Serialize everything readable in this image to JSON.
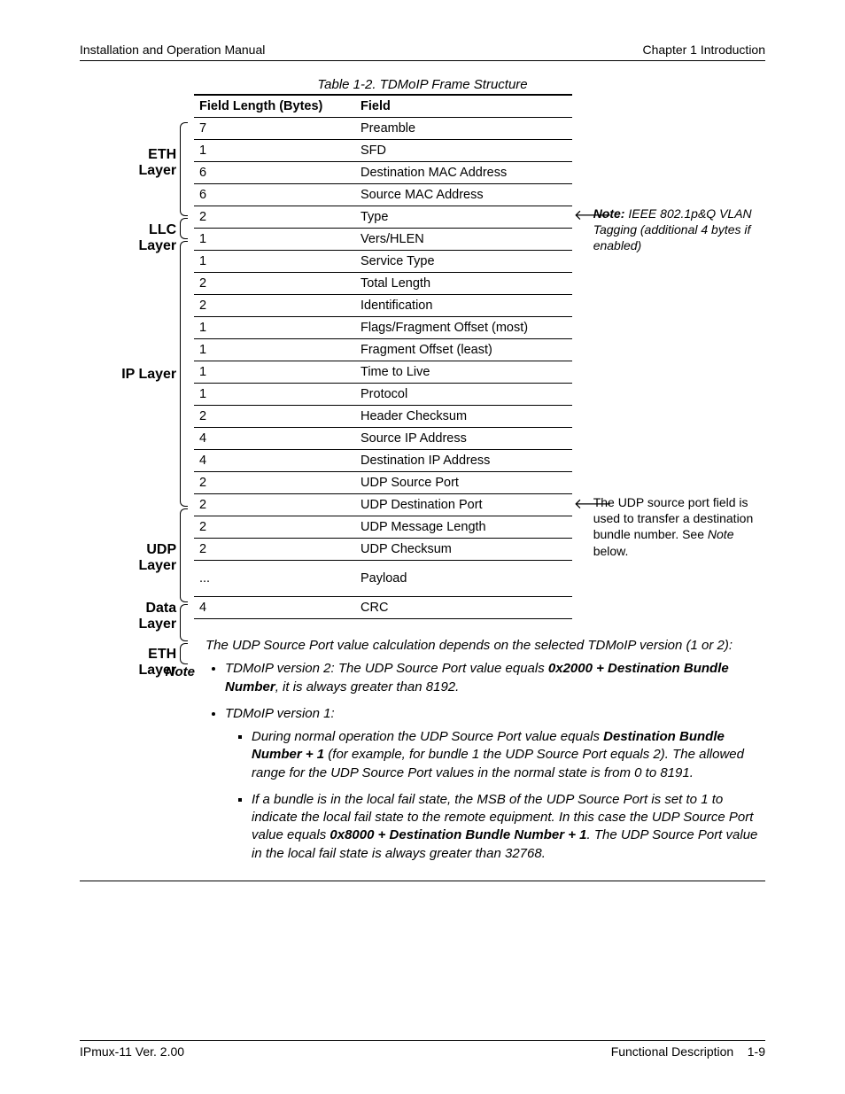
{
  "header": {
    "left": "Installation and Operation Manual",
    "right": "Chapter 1  Introduction"
  },
  "caption": "Table 1-2.  TDMoIP Frame Structure",
  "columns": {
    "c1": "Field Length (Bytes)",
    "c2": "Field"
  },
  "layers": {
    "eth": "ETH\nLayer",
    "llc": "LLC\nLayer",
    "ip": "IP Layer",
    "udp": "UDP\nLayer",
    "data": "Data\nLayer",
    "eth2": "ETH\nLayer"
  },
  "rows": [
    {
      "len": "7",
      "field": "Preamble"
    },
    {
      "len": "1",
      "field": "SFD"
    },
    {
      "len": "6",
      "field": "Destination MAC Address"
    },
    {
      "len": "6",
      "field": "Source MAC Address"
    },
    {
      "len": "2",
      "field": "Type"
    },
    {
      "len": "1",
      "field": "Vers/HLEN"
    },
    {
      "len": "1",
      "field": "Service Type"
    },
    {
      "len": "2",
      "field": "Total Length"
    },
    {
      "len": "2",
      "field": "Identification"
    },
    {
      "len": "1",
      "field": "Flags/Fragment Offset (most)"
    },
    {
      "len": "1",
      "field": "Fragment Offset (least)"
    },
    {
      "len": "1",
      "field": "Time to Live"
    },
    {
      "len": "1",
      "field": "Protocol"
    },
    {
      "len": "2",
      "field": "Header Checksum"
    },
    {
      "len": "4",
      "field": "Source IP Address"
    },
    {
      "len": "4",
      "field": "Destination IP Address"
    },
    {
      "len": "2",
      "field": "UDP Source Port"
    },
    {
      "len": "2",
      "field": "UDP Destination Port"
    },
    {
      "len": "2",
      "field": "UDP Message Length"
    },
    {
      "len": "2",
      "field": "UDP Checksum"
    },
    {
      "len": "...",
      "field": "Payload"
    },
    {
      "len": "4",
      "field": "CRC"
    }
  ],
  "annotations": {
    "vlan_note_bold": "Note:",
    "vlan_note": " IEEE 802.1p&Q VLAN Tagging (additional 4 bytes if enabled)",
    "udp_note": "The UDP source port field is used to transfer a destination bundle number. See ",
    "udp_note_italic": "Note",
    "udp_note_tail": " below."
  },
  "note": {
    "title": "Note",
    "intro": "The UDP Source Port value calculation depends on the selected TDMoIP version (1 or 2):",
    "bullet1_pre": "TDMoIP version 2: The UDP Source Port value equals ",
    "bullet1_bold": "0x2000 + Destination Bundle Number",
    "bullet1_post": ", it is always greater than 8192.",
    "bullet2": "TDMoIP version 1:",
    "sub1_pre": "During normal operation the UDP Source Port value equals ",
    "sub1_bold": "Destination Bundle Number + 1",
    "sub1_post": " (for example, for bundle 1 the UDP Source Port equals 2). The allowed range for the UDP Source Port values in the normal state is from 0 to 8191.",
    "sub2_pre": "If a bundle is in the local fail state, the MSB of the UDP Source Port is set to 1 to indicate the local fail state to the remote equipment. In this case the UDP Source Port value equals ",
    "sub2_bold": "0x8000 + Destination Bundle Number + 1",
    "sub2_post": ". The UDP Source Port value in the local fail state is always greater than 32768."
  },
  "footer": {
    "left": "IPmux-11 Ver. 2.00",
    "right_label": "Functional Description",
    "right_page": "1-9"
  }
}
